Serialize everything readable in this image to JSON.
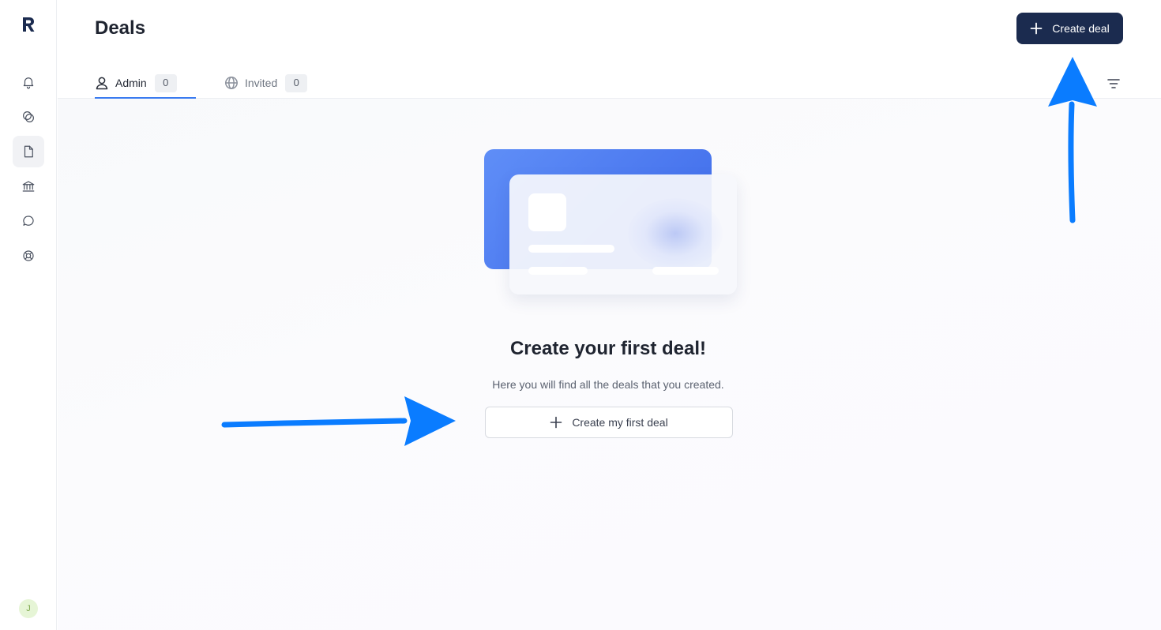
{
  "page": {
    "title": "Deals"
  },
  "header": {
    "create_label": "Create deal"
  },
  "tabs": [
    {
      "label": "Admin",
      "count": "0",
      "icon": "user-icon",
      "active": true
    },
    {
      "label": "Invited",
      "count": "0",
      "icon": "globe-icon",
      "active": false
    }
  ],
  "sidebar": {
    "logo": "R",
    "items": [
      {
        "icon": "bell-icon"
      },
      {
        "icon": "overlap-circles-icon"
      },
      {
        "icon": "document-icon",
        "active": true
      },
      {
        "icon": "bank-icon"
      },
      {
        "icon": "chat-bubble-icon"
      },
      {
        "icon": "lifebuoy-icon"
      }
    ],
    "avatar_initial": "J"
  },
  "empty_state": {
    "title": "Create your first deal!",
    "subtitle": "Here you will find all the deals that you created.",
    "button_label": "Create my first deal"
  },
  "colors": {
    "primary_button": "#1b2b4f",
    "active_tab_underline": "#3a7bf0",
    "annotation_arrow": "#0a7cff",
    "card_blue": "#4b78ef"
  }
}
